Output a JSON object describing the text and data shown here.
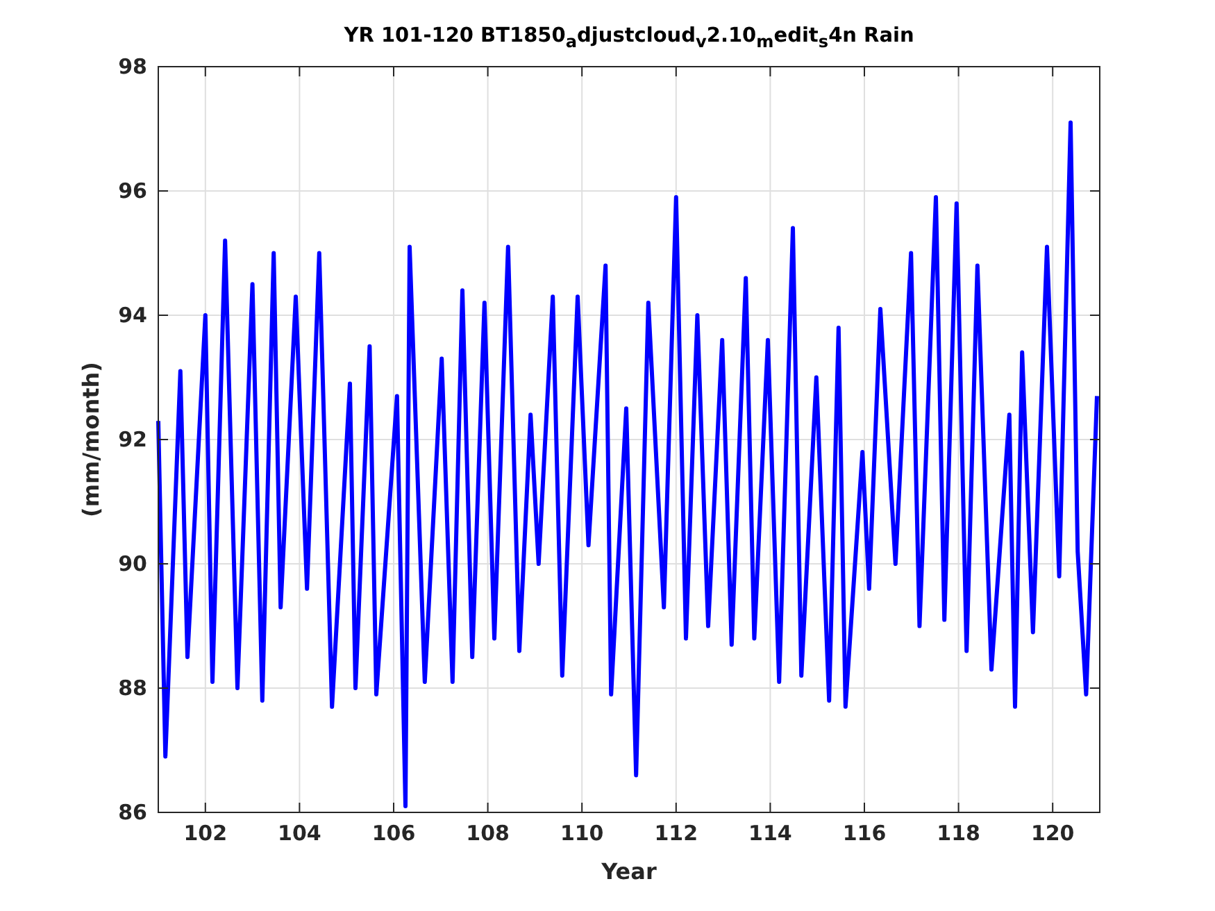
{
  "figure": {
    "chart_data": {
      "type": "line",
      "title": "YR 101-120 BT1850$_{a}$djustcloud$_{v}$2.10$_{m}$edit$_{s}$4n Rain",
      "xlabel": "Year",
      "ylabel": "(mm/month)",
      "grid": true,
      "xlim": [
        101,
        121
      ],
      "ylim": [
        86,
        98
      ],
      "xticks": [
        102,
        104,
        106,
        108,
        110,
        112,
        114,
        116,
        118,
        120
      ],
      "yticks": [
        86,
        88,
        90,
        92,
        94,
        96,
        98
      ],
      "x": [
        101.0,
        101.15,
        101.47,
        101.62,
        102.0,
        102.15,
        102.42,
        102.68,
        103.0,
        103.21,
        103.45,
        103.6,
        103.92,
        104.16,
        104.42,
        104.69,
        105.07,
        105.19,
        105.49,
        105.63,
        106.07,
        106.25,
        106.34,
        106.66,
        107.02,
        107.25,
        107.46,
        107.67,
        107.93,
        108.14,
        108.43,
        108.67,
        108.91,
        109.08,
        109.38,
        109.58,
        109.91,
        110.14,
        110.5,
        110.62,
        110.94,
        111.15,
        111.41,
        111.74,
        112.0,
        112.21,
        112.45,
        112.68,
        112.98,
        113.18,
        113.48,
        113.66,
        113.95,
        114.19,
        114.48,
        114.66,
        114.98,
        115.25,
        115.45,
        115.6,
        115.96,
        116.1,
        116.34,
        116.66,
        116.99,
        117.17,
        117.52,
        117.7,
        117.96,
        118.17,
        118.4,
        118.7,
        119.08,
        119.2,
        119.35,
        119.58,
        119.88,
        120.14,
        120.38,
        120.53,
        120.71,
        120.94
      ],
      "series": [
        {
          "color": "#0000ff",
          "values": [
            92.3,
            86.9,
            93.1,
            88.5,
            94.0,
            88.1,
            95.2,
            88.0,
            94.5,
            87.8,
            95.0,
            89.3,
            94.3,
            89.6,
            95.0,
            87.7,
            92.9,
            88.0,
            93.5,
            87.9,
            92.7,
            86.1,
            95.1,
            88.1,
            93.3,
            88.1,
            94.4,
            88.5,
            94.2,
            88.8,
            95.1,
            88.6,
            92.4,
            90.0,
            94.3,
            88.2,
            94.3,
            90.3,
            94.8,
            87.9,
            92.5,
            86.6,
            94.2,
            89.3,
            95.9,
            88.8,
            94.0,
            89.0,
            93.6,
            88.7,
            94.6,
            88.8,
            93.6,
            88.1,
            95.4,
            88.2,
            93.0,
            87.8,
            93.8,
            87.7,
            91.8,
            89.6,
            94.1,
            90.0,
            95.0,
            89.0,
            95.9,
            89.1,
            95.8,
            88.6,
            94.8,
            88.3,
            92.4,
            87.7,
            93.4,
            88.9,
            95.1,
            89.8,
            97.1,
            90.2,
            87.9,
            92.7
          ]
        }
      ]
    }
  }
}
